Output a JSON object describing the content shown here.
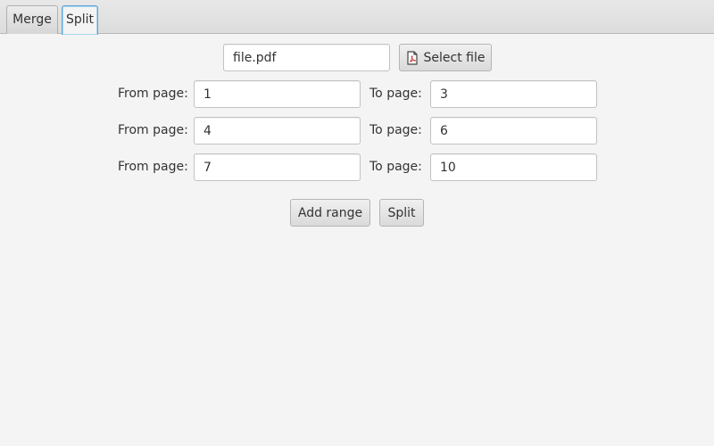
{
  "tabs": [
    {
      "label": "Merge",
      "selected": false
    },
    {
      "label": "Split",
      "selected": true
    }
  ],
  "file": {
    "value": "file.pdf",
    "select_button_label": "Select file",
    "select_button_icon": "pdf-file-icon"
  },
  "ranges": [
    {
      "from_label": "From page:",
      "from_value": "1",
      "to_label": "To page:",
      "to_value": "3"
    },
    {
      "from_label": "From page:",
      "from_value": "4",
      "to_label": "To page:",
      "to_value": "6"
    },
    {
      "from_label": "From page:",
      "from_value": "7",
      "to_label": "To page:",
      "to_value": "10"
    }
  ],
  "actions": {
    "add_range_label": "Add range",
    "split_label": "Split"
  },
  "colors": {
    "background": "#f4f4f4",
    "selected_tab_border": "#5aa7d6"
  }
}
